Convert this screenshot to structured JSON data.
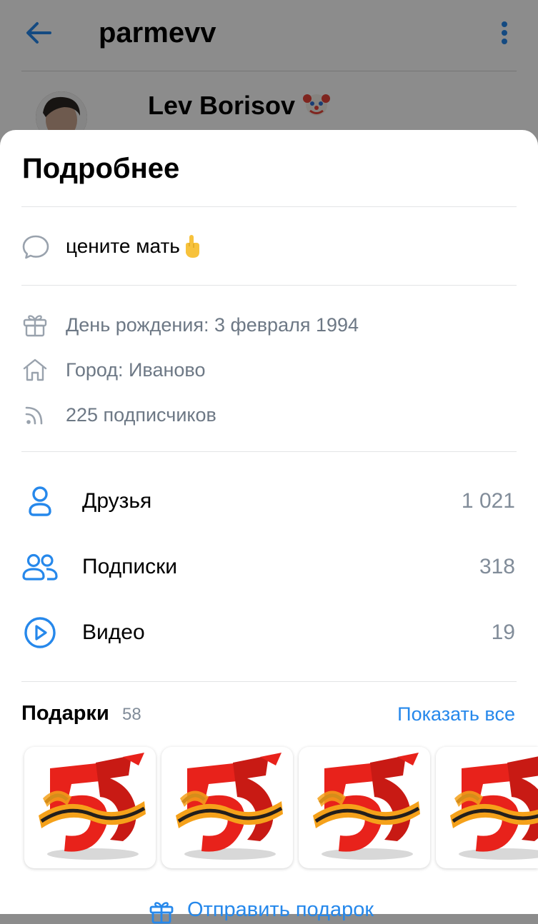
{
  "header": {
    "title": "parmevv"
  },
  "profile": {
    "name": "Lev Borisov"
  },
  "sheet": {
    "title": "Подробнее",
    "status": "цените мать",
    "info": [
      {
        "icon": "gift-icon",
        "text": "День рождения: 3 февраля 1994"
      },
      {
        "icon": "home-icon",
        "text": "Город: Иваново"
      },
      {
        "icon": "rss-icon",
        "text": "225 подписчиков"
      }
    ],
    "counters": [
      {
        "icon": "user-icon",
        "label": "Друзья",
        "value": "1 021"
      },
      {
        "icon": "users-icon",
        "label": "Подписки",
        "value": "318"
      },
      {
        "icon": "play-circle-icon",
        "label": "Видео",
        "value": "19"
      }
    ],
    "gifts": {
      "title": "Подарки",
      "count": "58",
      "show_all": "Показать все",
      "send": "Отправить подарок"
    }
  },
  "colors": {
    "accent": "#2688eb",
    "secondary_text": "#6d7885",
    "counter_text": "#818c99",
    "icon_gray": "#99a2ad"
  }
}
